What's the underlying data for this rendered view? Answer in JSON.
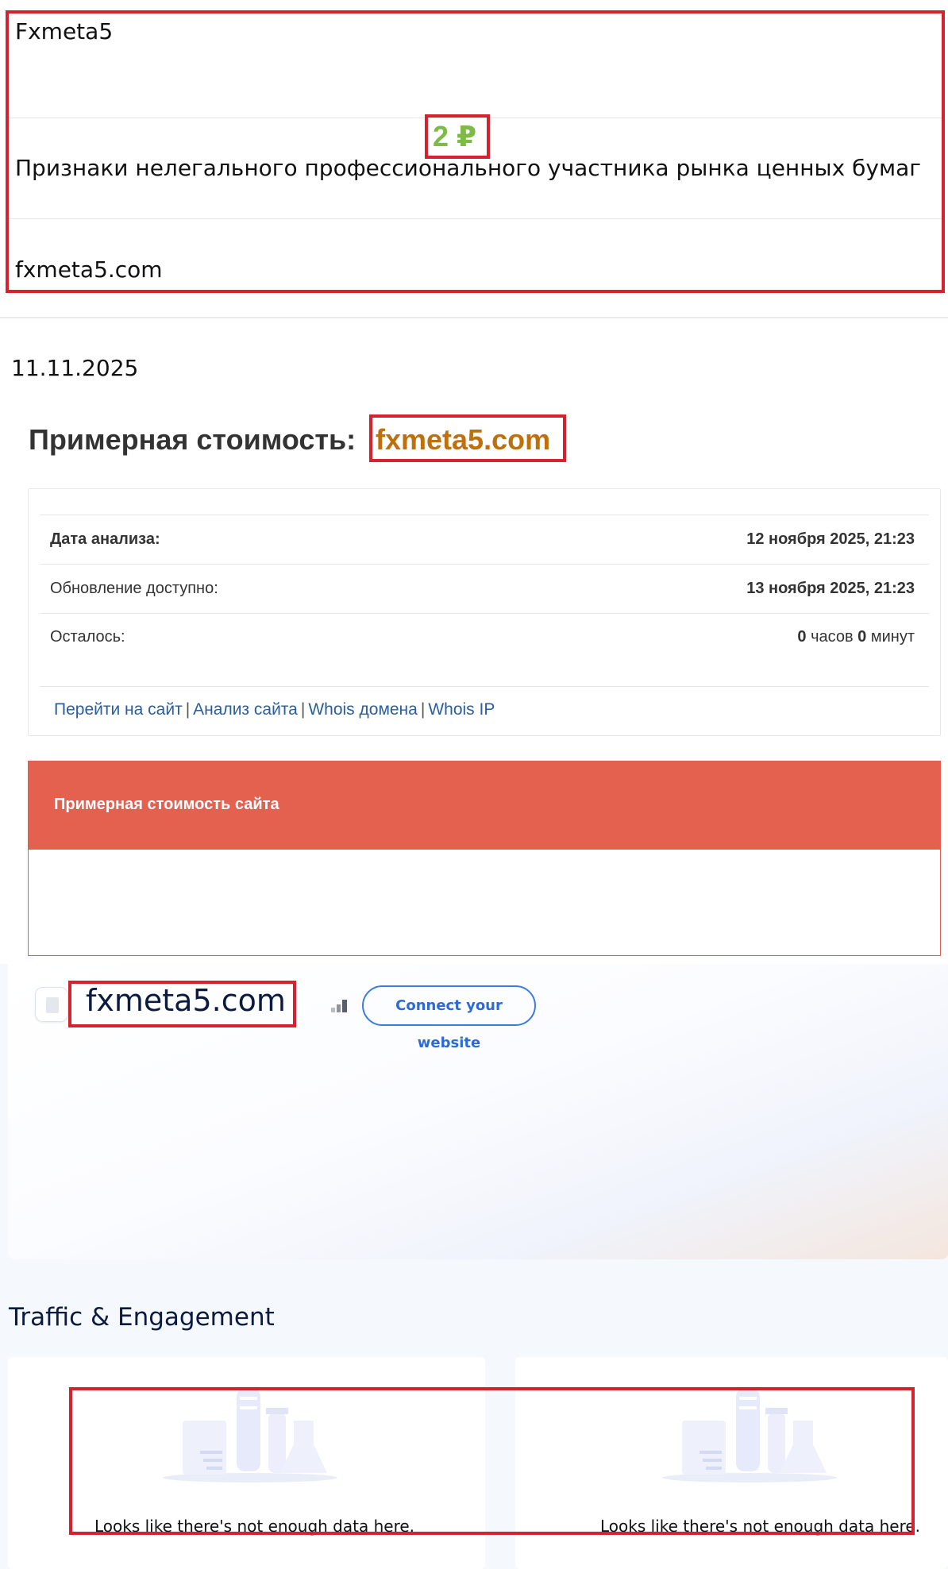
{
  "info": {
    "name": "Fxmeta5",
    "category": "Признаки нелегального профессионального участника рынка ценных бумаг",
    "site": "fxmeta5.com"
  },
  "date": "11.11.2025",
  "estimate": {
    "title": "Примерная стоимость:",
    "domain": "fxmeta5.com",
    "rows": [
      {
        "label": "Дата анализа:",
        "value": "12 ноября 2025, 21:23"
      },
      {
        "label": "Обновление доступно:",
        "value": "13 ноября 2025, 21:23"
      },
      {
        "label": "Осталось:",
        "hours_num": "0",
        "hours_word": "часов",
        "minutes_num": "0",
        "minutes_word": "минут"
      }
    ],
    "links": [
      "Перейти на сайт",
      "Анализ сайта",
      "Whois домена",
      "Whois IP"
    ],
    "links_separator": "|",
    "cost_header": "Примерная стоимость сайта",
    "cost_value": "2 ₽"
  },
  "website": {
    "domain": "fxmeta5.com",
    "connect_label": "Connect your website",
    "favicon_icon": "document-icon",
    "rank_icon": "bar-chart-icon"
  },
  "traffic": {
    "title": "Traffic & Engagement",
    "empty_message": "Looks like there's not enough data here.",
    "empty_icon": "lab-flask-icon"
  },
  "colors": {
    "highlight_border": "#d4232e",
    "domain_accent": "#c0700a",
    "cost_header_bg": "#e46150",
    "cost_value": "#7dbb46",
    "link": "#2b5e9e",
    "connect_button": "#2c6bd6"
  }
}
